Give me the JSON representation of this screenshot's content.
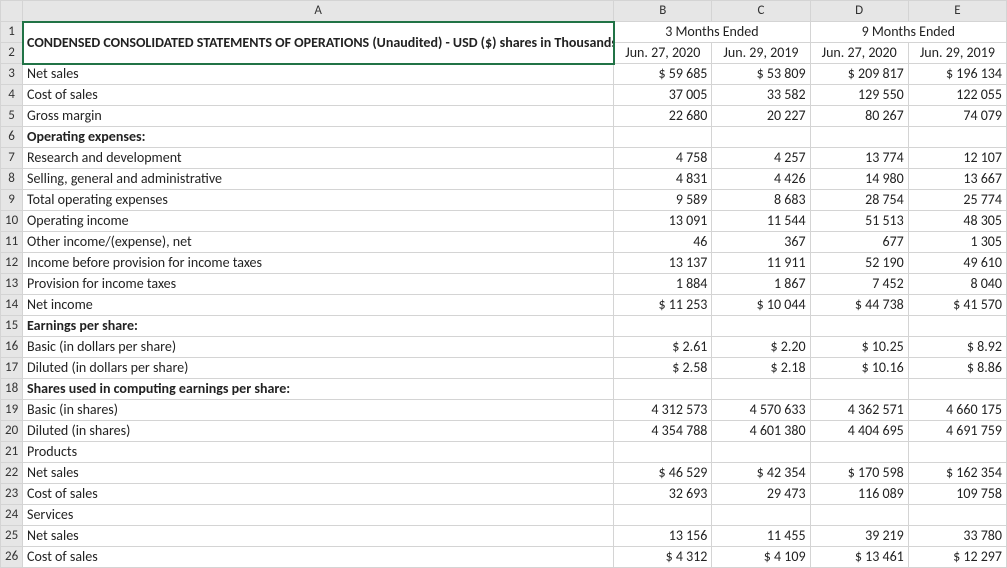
{
  "columns": [
    "A",
    "B",
    "C",
    "D",
    "E"
  ],
  "title": "CONDENSED CONSOLIDATED STATEMENTS OF OPERATIONS (Unaudited) - USD ($) shares in Thousands, $ in Millions",
  "period_groups": [
    "3 Months Ended",
    "9 Months Ended"
  ],
  "period_dates": [
    "Jun. 27, 2020",
    "Jun. 29, 2019",
    "Jun. 27, 2020",
    "Jun. 29, 2019"
  ],
  "rows": [
    {
      "n": 3,
      "label": "Net sales",
      "v": [
        "$ 59 685",
        "$ 53 809",
        "$ 209 817",
        "$ 196 134"
      ]
    },
    {
      "n": 4,
      "label": "Cost of sales",
      "v": [
        "37 005",
        "33 582",
        "129 550",
        "122 055"
      ]
    },
    {
      "n": 5,
      "label": "Gross margin",
      "v": [
        "22 680",
        "20 227",
        "80 267",
        "74 079"
      ]
    },
    {
      "n": 6,
      "label": "Operating expenses:",
      "bold": true,
      "v": [
        "",
        "",
        "",
        ""
      ]
    },
    {
      "n": 7,
      "label": "Research and development",
      "v": [
        "4 758",
        "4 257",
        "13 774",
        "12 107"
      ]
    },
    {
      "n": 8,
      "label": "Selling, general and administrative",
      "v": [
        "4 831",
        "4 426",
        "14 980",
        "13 667"
      ]
    },
    {
      "n": 9,
      "label": "Total operating expenses",
      "v": [
        "9 589",
        "8 683",
        "28 754",
        "25 774"
      ]
    },
    {
      "n": 10,
      "label": "Operating income",
      "v": [
        "13 091",
        "11 544",
        "51 513",
        "48 305"
      ]
    },
    {
      "n": 11,
      "label": "Other income/(expense), net",
      "v": [
        "46",
        "367",
        "677",
        "1 305"
      ]
    },
    {
      "n": 12,
      "label": "Income before provision for income taxes",
      "v": [
        "13 137",
        "11 911",
        "52 190",
        "49 610"
      ]
    },
    {
      "n": 13,
      "label": "Provision for income taxes",
      "v": [
        "1 884",
        "1 867",
        "7 452",
        "8 040"
      ]
    },
    {
      "n": 14,
      "label": "Net income",
      "v": [
        "$ 11 253",
        "$ 10 044",
        "$ 44 738",
        "$ 41 570"
      ]
    },
    {
      "n": 15,
      "label": "Earnings per share:",
      "bold": true,
      "v": [
        "",
        "",
        "",
        ""
      ]
    },
    {
      "n": 16,
      "label": "Basic (in dollars per share)",
      "v": [
        "$ 2.61",
        "$ 2.20",
        "$ 10.25",
        "$ 8.92"
      ]
    },
    {
      "n": 17,
      "label": "Diluted (in dollars per share)",
      "v": [
        "$ 2.58",
        "$ 2.18",
        "$ 10.16",
        "$ 8.86"
      ]
    },
    {
      "n": 18,
      "label": "Shares used in computing earnings per share:",
      "bold": true,
      "v": [
        "",
        "",
        "",
        ""
      ]
    },
    {
      "n": 19,
      "label": "Basic (in shares)",
      "v": [
        "4 312 573",
        "4 570 633",
        "4 362 571",
        "4 660 175"
      ]
    },
    {
      "n": 20,
      "label": "Diluted (in shares)",
      "v": [
        "4 354 788",
        "4 601 380",
        "4 404 695",
        "4 691 759"
      ]
    },
    {
      "n": 21,
      "label": "Products",
      "v": [
        "",
        "",
        "",
        ""
      ]
    },
    {
      "n": 22,
      "label": "Net sales",
      "v": [
        "$ 46 529",
        "$ 42 354",
        "$ 170 598",
        "$ 162 354"
      ]
    },
    {
      "n": 23,
      "label": "Cost of sales",
      "v": [
        "32 693",
        "29 473",
        "116 089",
        "109 758"
      ]
    },
    {
      "n": 24,
      "label": "Services",
      "v": [
        "",
        "",
        "",
        ""
      ]
    },
    {
      "n": 25,
      "label": "Net sales",
      "v": [
        "13 156",
        "11 455",
        "39 219",
        "33 780"
      ]
    },
    {
      "n": 26,
      "label": "Cost of sales",
      "v": [
        "$ 4 312",
        "$ 4 109",
        "$ 13 461",
        "$ 12 297"
      ]
    }
  ],
  "chart_data": {
    "type": "table",
    "title": "CONDENSED CONSOLIDATED STATEMENTS OF OPERATIONS (Unaudited) - USD ($) shares in Thousands, $ in Millions",
    "column_groups": [
      {
        "label": "3 Months Ended",
        "columns": [
          "Jun. 27, 2020",
          "Jun. 29, 2019"
        ]
      },
      {
        "label": "9 Months Ended",
        "columns": [
          "Jun. 27, 2020",
          "Jun. 29, 2019"
        ]
      }
    ],
    "rows": [
      {
        "label": "Net sales",
        "values": [
          59685,
          53809,
          209817,
          196134
        ],
        "unit": "$M"
      },
      {
        "label": "Cost of sales",
        "values": [
          37005,
          33582,
          129550,
          122055
        ],
        "unit": "$M"
      },
      {
        "label": "Gross margin",
        "values": [
          22680,
          20227,
          80267,
          74079
        ],
        "unit": "$M"
      },
      {
        "label": "Operating expenses:",
        "section": true
      },
      {
        "label": "Research and development",
        "values": [
          4758,
          4257,
          13774,
          12107
        ],
        "unit": "$M"
      },
      {
        "label": "Selling, general and administrative",
        "values": [
          4831,
          4426,
          14980,
          13667
        ],
        "unit": "$M"
      },
      {
        "label": "Total operating expenses",
        "values": [
          9589,
          8683,
          28754,
          25774
        ],
        "unit": "$M"
      },
      {
        "label": "Operating income",
        "values": [
          13091,
          11544,
          51513,
          48305
        ],
        "unit": "$M"
      },
      {
        "label": "Other income/(expense), net",
        "values": [
          46,
          367,
          677,
          1305
        ],
        "unit": "$M"
      },
      {
        "label": "Income before provision for income taxes",
        "values": [
          13137,
          11911,
          52190,
          49610
        ],
        "unit": "$M"
      },
      {
        "label": "Provision for income taxes",
        "values": [
          1884,
          1867,
          7452,
          8040
        ],
        "unit": "$M"
      },
      {
        "label": "Net income",
        "values": [
          11253,
          10044,
          44738,
          41570
        ],
        "unit": "$M"
      },
      {
        "label": "Earnings per share:",
        "section": true
      },
      {
        "label": "Basic (in dollars per share)",
        "values": [
          2.61,
          2.2,
          10.25,
          8.92
        ],
        "unit": "$"
      },
      {
        "label": "Diluted (in dollars per share)",
        "values": [
          2.58,
          2.18,
          10.16,
          8.86
        ],
        "unit": "$"
      },
      {
        "label": "Shares used in computing earnings per share:",
        "section": true
      },
      {
        "label": "Basic (in shares)",
        "values": [
          4312573,
          4570633,
          4362571,
          4660175
        ],
        "unit": "thousands"
      },
      {
        "label": "Diluted (in shares)",
        "values": [
          4354788,
          4601380,
          4404695,
          4691759
        ],
        "unit": "thousands"
      },
      {
        "label": "Products",
        "section": true
      },
      {
        "label": "Net sales",
        "values": [
          46529,
          42354,
          170598,
          162354
        ],
        "unit": "$M"
      },
      {
        "label": "Cost of sales",
        "values": [
          32693,
          29473,
          116089,
          109758
        ],
        "unit": "$M"
      },
      {
        "label": "Services",
        "section": true
      },
      {
        "label": "Net sales",
        "values": [
          13156,
          11455,
          39219,
          33780
        ],
        "unit": "$M"
      },
      {
        "label": "Cost of sales",
        "values": [
          4312,
          4109,
          13461,
          12297
        ],
        "unit": "$M"
      }
    ]
  }
}
